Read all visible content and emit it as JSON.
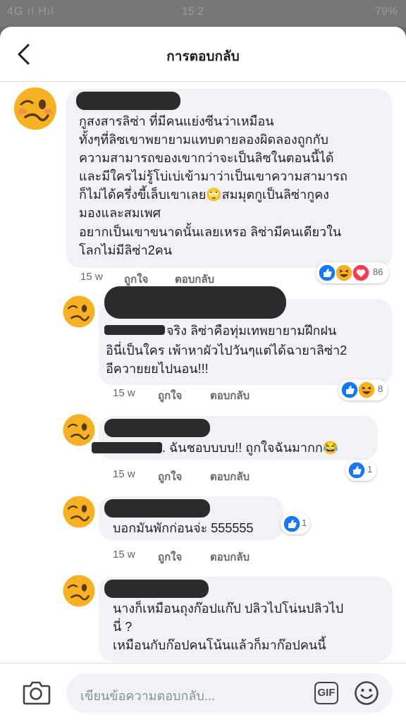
{
  "status_bar": {
    "left": "4G ıl Hıl",
    "time": "15:2",
    "right": "79%"
  },
  "header": {
    "title": "การตอบกลับ"
  },
  "comments": [
    {
      "lines": [
        "กูสงสารลิซ่า ที่มีคนแย่งซีนว่าเหมือน",
        "ทั้งๆที่ลิซเขาพยายามแทบตายลองผิดลองถูกกับ",
        "ความสามารถของเขากว่าจะเป็นลิซในตอนนี้ได้",
        "และมีใครไม่รู้โบ่เบ่เข้ามาว่าเป็นเขาความสามารถ",
        "ก็ไม่ได้ครึ่งขี้เล็บเขาเลย🙄สมมุตกูเป็นลิซ่ากูคง",
        "มองและสมเพศ",
        "อยากเป็นเขาขนาดนั้นเลยเหรอ ลิซ่ามีคนเดียวใน",
        "โลกไม่มีลิซ่า2คน"
      ],
      "time": "15 w",
      "like": "ถูกใจ",
      "reply": "ตอบกลับ",
      "reaction_count": "86"
    },
    {
      "lines": [
        "จริง ลิซ่าคือทุ่มเทพยายามฝึกฝน",
        "อินี่เป็นใคร เพ้าหาผัวไปวันๆแต่ได้ฉายาลิซ่า2",
        "อีควายยยไปนอน!!!"
      ],
      "time": "15 w",
      "like": "ถูกใจ",
      "reply": "ตอบกลับ",
      "reaction_count": "8"
    },
    {
      "lines": [
        ". ฉันชอบบบบ!! ถูกใจฉันมากก😂"
      ],
      "time": "15 w",
      "like": "ถูกใจ",
      "reply": "ตอบกลับ",
      "reaction_count": "1"
    },
    {
      "lines": [
        "บอกมันพักก่อนจ่ะ 555555"
      ],
      "time": "15 w",
      "like": "ถูกใจ",
      "reply": "ตอบกลับ",
      "reaction_count": "1"
    },
    {
      "lines": [
        "นางก็เหมือนถุงก๊อปแก๊ป ปลิวไปโน่นปลิวไป",
        "นี่ ?",
        "เหมือนกับก๊อปคนโน้นแล้วก็มาก๊อปคนนี้"
      ]
    }
  ],
  "composer": {
    "placeholder": "เขียนข้อความตอบกลับ...",
    "gif_label": "GIF"
  },
  "colors": {
    "like_blue": "#1877f2",
    "love_red": "#f33e58",
    "haha_yellow": "#f7b125",
    "bubble": "#f0f2f5"
  }
}
